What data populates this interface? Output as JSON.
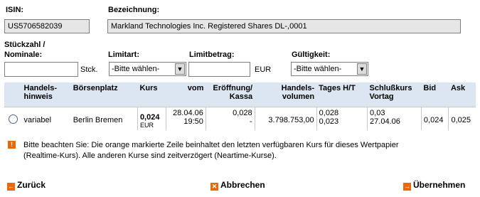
{
  "isin": {
    "label": "ISIN:",
    "value": "US5706582039"
  },
  "bezeichnung": {
    "label": "Bezeichnung:",
    "value": "Markland Technologies Inc. Registered Shares DL-,0001"
  },
  "stueckzahl": {
    "label_line1": "Stückzahl /",
    "label_line2": "Nominale:",
    "unit": "Stck."
  },
  "limitart": {
    "label": "Limitart:",
    "selected": "-Bitte wählen-"
  },
  "limitbetrag": {
    "label": "Limitbetrag:",
    "unit": "EUR"
  },
  "gueltigkeit": {
    "label": "Gültigkeit:",
    "selected": "-Bitte wählen-"
  },
  "table": {
    "headers": {
      "handelshinweis": [
        "Handels-",
        "hinweis"
      ],
      "boersenplatz": "Börsenplatz",
      "kurs": "Kurs",
      "vom": "vom",
      "eroeffnung": [
        "Eröffnung/",
        "Kassa"
      ],
      "volumen": [
        "Handels-",
        "volumen"
      ],
      "tages": "Tages H/T",
      "schluss": [
        "Schlußkurs",
        "Vortag"
      ],
      "bid": "Bid",
      "ask": "Ask"
    },
    "rows": [
      {
        "hinweis": "variabel",
        "boersenplatz": "Berlin Bremen",
        "kurs": "0,024",
        "kurs_currency": "EUR",
        "vom_date": "28.04.06",
        "vom_time": "19:50",
        "eroeffnung": "0,028",
        "kassa": "-",
        "volumen": "3.798.753,00",
        "tages_hoch": "0,028",
        "tages_tief": "0,023",
        "schluss": "0,03",
        "schluss_date": "27.04.06",
        "bid": "0,024",
        "ask": "0,025"
      }
    ]
  },
  "notice": {
    "icon": "info-icon",
    "line1": "Bitte beachten Sie: Die orange markierte Zeile beinhaltet den letzten verfügbaren Kurs für dieses Wertpapier",
    "line2": "(Realtime-Kurs). Alle anderen Kurse sind zeitverzögert (Neartime-Kurse)."
  },
  "buttons": {
    "back": "Zurück",
    "cancel": "Abbrechen",
    "accept": "Übernehmen"
  },
  "colors": {
    "accent": "#e8680c",
    "header_bg": "#dce6f2",
    "readonly_bg": "#e6e6e6"
  }
}
